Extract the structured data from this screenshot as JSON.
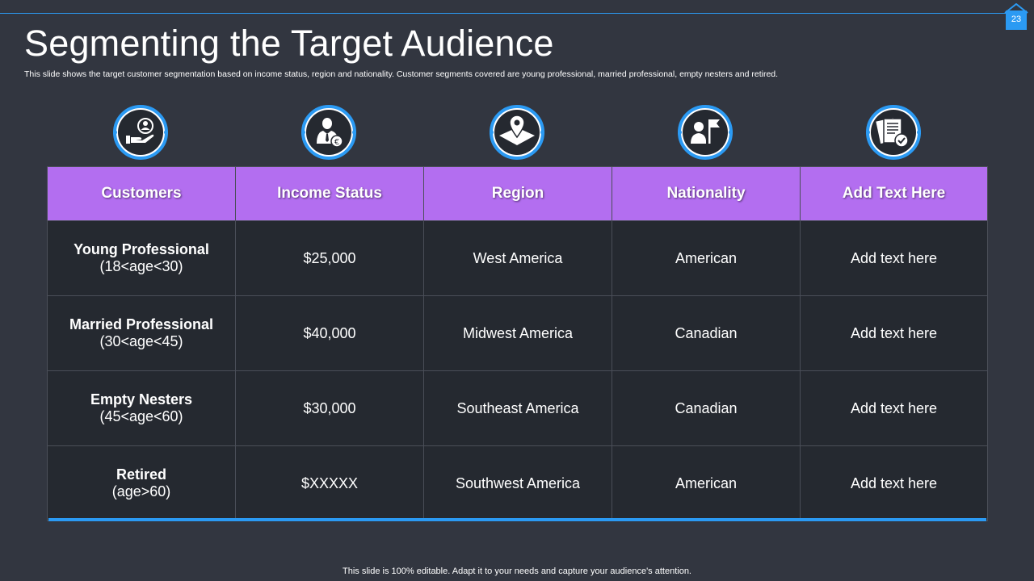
{
  "slide": {
    "page_number": "23",
    "title": "Segmenting the Target Audience",
    "subtitle": "This slide shows the target customer segmentation based on income status, region and nationality. Customer segments covered are young professional, married professional, empty nesters and retired.",
    "footer": "This slide is 100% editable. Adapt it to your needs and capture your audience's attention."
  },
  "icons": [
    "customer-hand-icon",
    "businessman-euro-icon",
    "location-pin-icon",
    "person-flag-icon",
    "documents-check-icon"
  ],
  "colors": {
    "background": "#323640",
    "accent_blue": "#2b9af3",
    "header_purple": "#b36ef0",
    "cell_dark": "#252930"
  },
  "table": {
    "headers": [
      "Customers",
      "Income Status",
      "Region",
      "Nationality",
      "Add Text Here"
    ],
    "rows": [
      {
        "customer": "Young Professional",
        "age": "(18<age<30)",
        "income": "$25,000",
        "region": "West America",
        "nationality": "American",
        "extra": "Add text here"
      },
      {
        "customer": "Married Professional",
        "age": "(30<age<45)",
        "income": "$40,000",
        "region": "Midwest America",
        "nationality": "Canadian",
        "extra": "Add text here"
      },
      {
        "customer": "Empty Nesters",
        "age": "(45<age<60)",
        "income": "$30,000",
        "region": "Southeast America",
        "nationality": "Canadian",
        "extra": "Add text here"
      },
      {
        "customer": "Retired",
        "age": "(age>60)",
        "income": "$XXXXX",
        "region": "Southwest America",
        "nationality": "American",
        "extra": "Add text here"
      }
    ]
  }
}
